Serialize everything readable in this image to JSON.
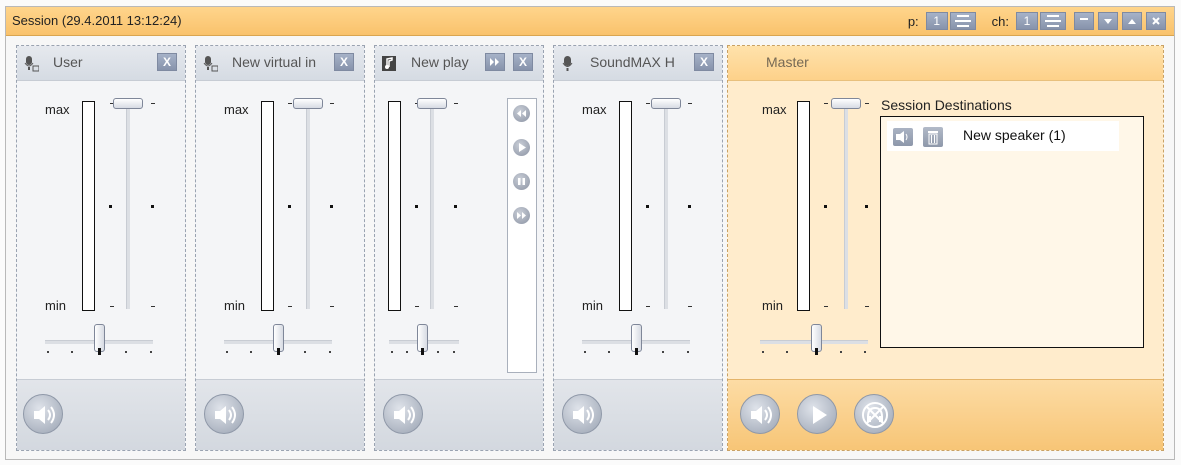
{
  "window": {
    "title": "Session (29.4.2011 13:12:24)",
    "page_label": "p:",
    "page_value": "1",
    "channel_label": "ch:",
    "channel_value": "1",
    "buttons": [
      "minimize",
      "move-down",
      "move-up",
      "close"
    ]
  },
  "mixer_labels": {
    "max": "max",
    "min": "min"
  },
  "strips": [
    {
      "name": "User",
      "icon": "microphone-icon",
      "close_label": "X"
    },
    {
      "name": "New virtual in",
      "icon": "microphone-icon",
      "close_label": "X"
    },
    {
      "name": "New play",
      "icon": "music-note-icon",
      "close_label": "X",
      "extra_button": "forward-icon",
      "transport": [
        "rewind-icon",
        "play-icon",
        "pause-icon",
        "fast-forward-icon"
      ]
    },
    {
      "name": "SoundMAX H",
      "icon": "microphone-icon",
      "close_label": "X"
    }
  ],
  "master": {
    "name": "Master",
    "destinations_title": "Session Destinations",
    "destinations": [
      {
        "label": "New speaker (1)"
      }
    ],
    "footer_buttons": [
      "speaker-icon",
      "play-icon",
      "disabled-headset-icon"
    ]
  },
  "colors": {
    "accent": "#fbc46d",
    "panel": "#d7dce4",
    "button": "#8f9ab0"
  }
}
